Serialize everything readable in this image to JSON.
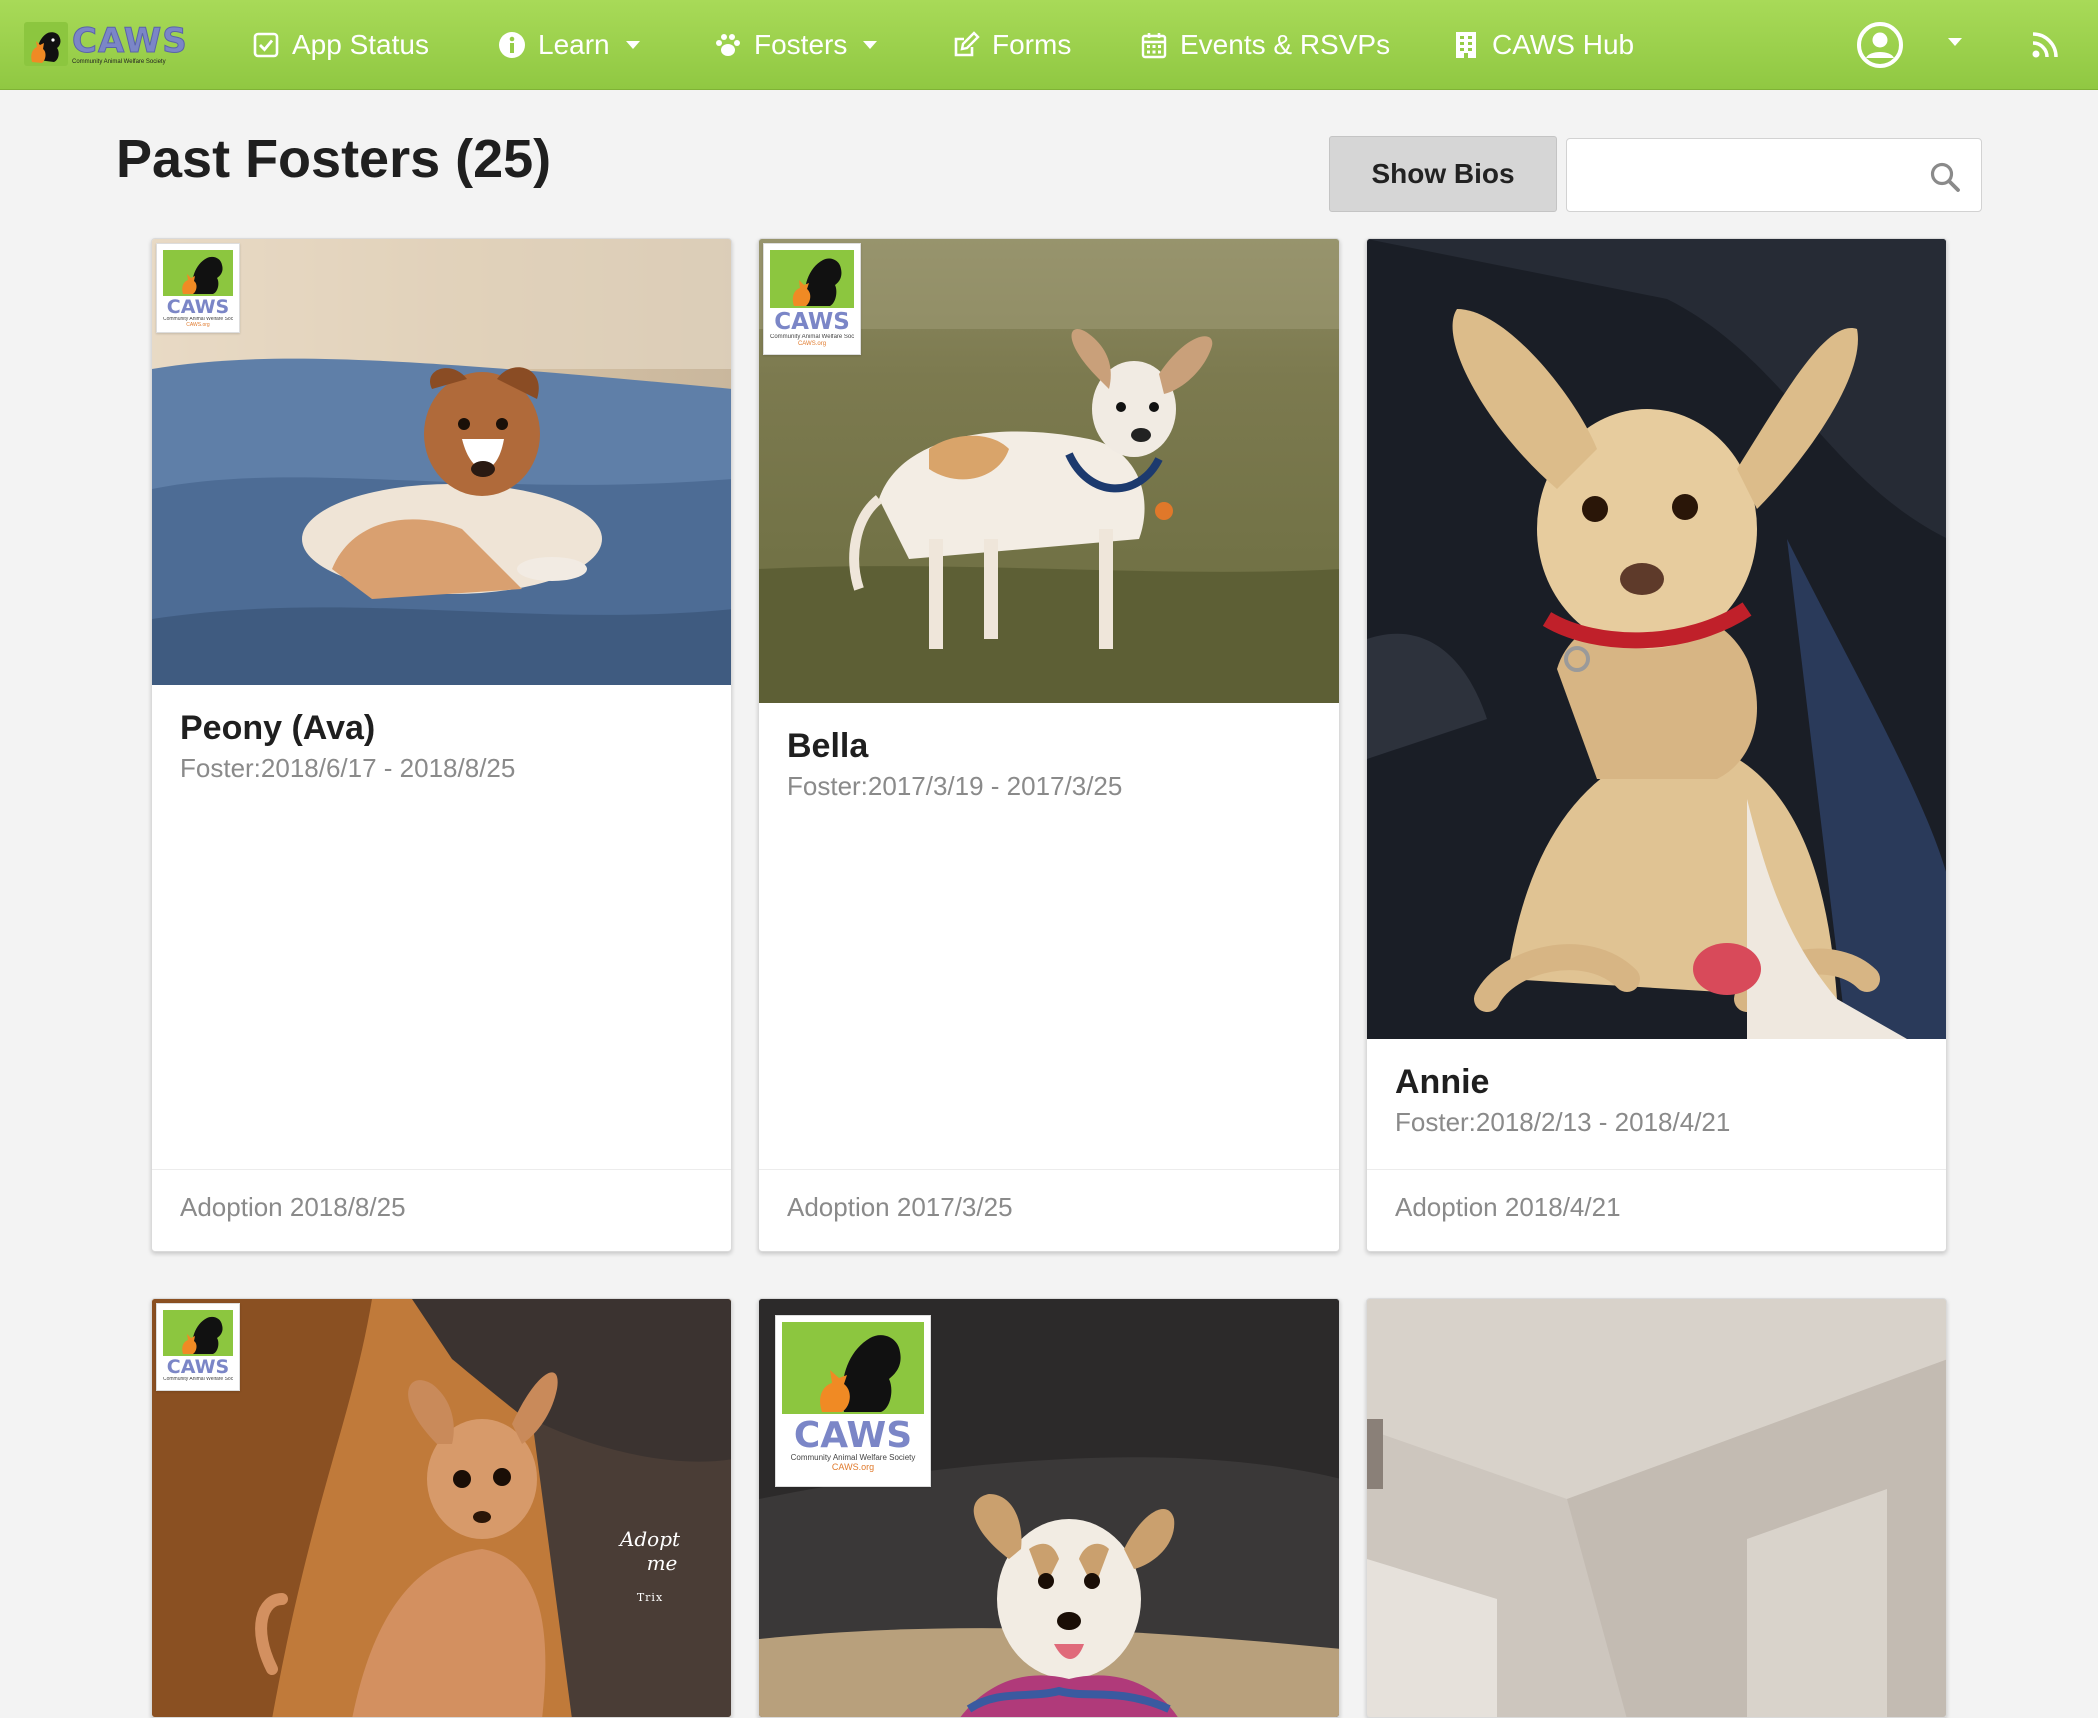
{
  "brand": {
    "name": "CAWS",
    "tagline": "Community Animal Welfare Society"
  },
  "nav": {
    "items": [
      {
        "label": "App Status",
        "icon": "check-square-icon"
      },
      {
        "label": "Learn",
        "icon": "info-circle-icon",
        "dropdown": true
      },
      {
        "label": "Fosters",
        "icon": "paw-icon",
        "dropdown": true
      },
      {
        "label": "Forms",
        "icon": "edit-icon"
      },
      {
        "label": "Events & RSVPs",
        "icon": "calendar-icon"
      },
      {
        "label": "CAWS Hub",
        "icon": "building-icon"
      }
    ],
    "user_icon": "user-circle-icon",
    "rss_icon": "rss-icon"
  },
  "page": {
    "title": "Past Fosters (25)",
    "show_bios_label": "Show Bios",
    "search": {
      "value": "",
      "placeholder": ""
    }
  },
  "logo_badge": {
    "word": "CAWS",
    "sub": "Community Animal Welfare Society",
    "url": "CAWS.org"
  },
  "fosters": [
    {
      "name": "Peony (Ava)",
      "dates": "Foster:2018/6/17 - 2018/8/25",
      "outcome": "Adoption 2018/8/25"
    },
    {
      "name": "Bella",
      "dates": "Foster:2017/3/19 - 2017/3/25",
      "outcome": "Adoption 2017/3/25"
    },
    {
      "name": "Annie",
      "dates": "Foster:2018/2/13 - 2018/4/21",
      "outcome": "Adoption 2018/4/21"
    },
    {
      "photo_text": {
        "adopt": "Adopt",
        "me": "me",
        "name": "Trix"
      }
    },
    {},
    {}
  ],
  "colors": {
    "navbar": "#9bd14c",
    "brand_text": "#7b86c7",
    "logo_green": "#8cc63f",
    "logo_orange": "#e07a2c",
    "muted_text": "#8a8a8a",
    "page_bg": "#f3f3f3"
  }
}
